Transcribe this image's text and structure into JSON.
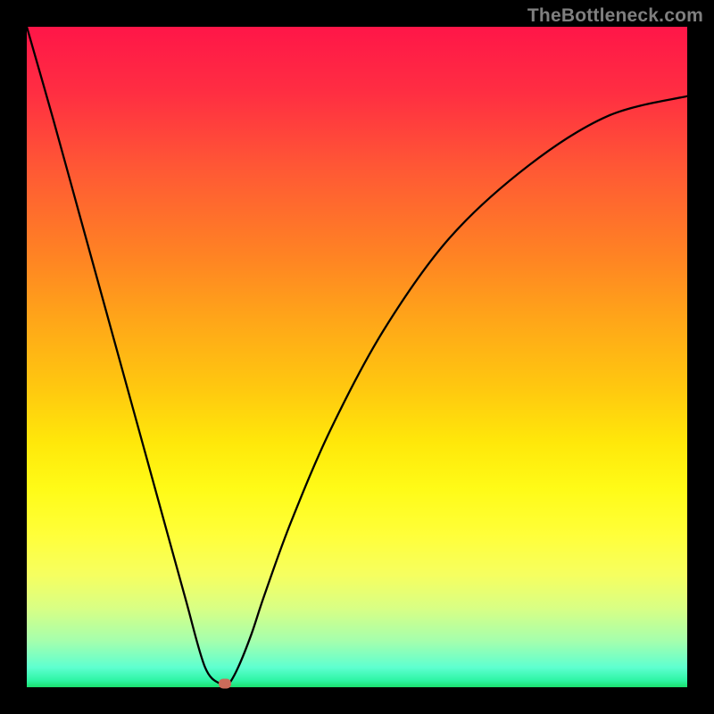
{
  "watermark_text": "TheBottleneck.com",
  "chart_data": {
    "type": "line",
    "title": "",
    "xlabel": "",
    "ylabel": "",
    "xlim": [
      0,
      100
    ],
    "ylim": [
      0,
      100
    ],
    "grid": false,
    "legend": false,
    "background_gradient": {
      "orientation": "vertical",
      "stops": [
        {
          "pos": 0,
          "color": "#ff1648"
        },
        {
          "pos": 50,
          "color": "#ffb810"
        },
        {
          "pos": 75,
          "color": "#ffff3a"
        },
        {
          "pos": 100,
          "color": "#1be06e"
        }
      ]
    },
    "series": [
      {
        "name": "bottleneck-curve",
        "color": "#000000",
        "x": [
          0,
          4,
          8,
          12,
          16,
          20,
          24,
          27,
          29.5,
          30.5,
          32,
          34,
          36,
          40,
          46,
          54,
          64,
          76,
          88,
          100
        ],
        "y": [
          100,
          86,
          71.5,
          57,
          42.5,
          28,
          13.5,
          3,
          0.4,
          0.4,
          3,
          8,
          14,
          25,
          39,
          54,
          68,
          79,
          86.5,
          89.5
        ]
      }
    ],
    "marker": {
      "name": "optimal-point",
      "x": 30,
      "y": 0.5,
      "shape": "rounded-rect",
      "color": "#cc6b5a"
    }
  }
}
